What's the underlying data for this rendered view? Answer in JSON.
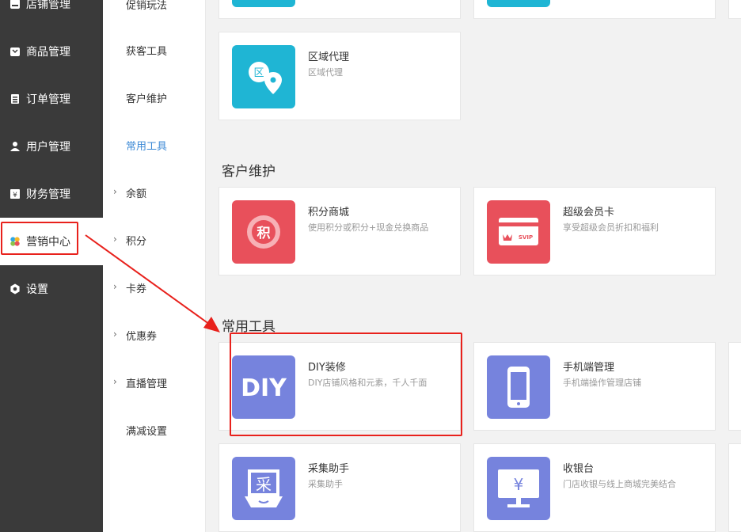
{
  "sidebar": {
    "items": [
      {
        "label": "店铺管理",
        "icon": "store-icon"
      },
      {
        "label": "商品管理",
        "icon": "goods-icon"
      },
      {
        "label": "订单管理",
        "icon": "order-icon"
      },
      {
        "label": "用户管理",
        "icon": "user-icon"
      },
      {
        "label": "财务管理",
        "icon": "finance-icon"
      },
      {
        "label": "营销中心",
        "icon": "marketing-icon"
      },
      {
        "label": "设置",
        "icon": "settings-icon"
      }
    ]
  },
  "subnav": {
    "items": [
      {
        "label": "促销玩法"
      },
      {
        "label": "获客工具"
      },
      {
        "label": "客户维护"
      },
      {
        "label": "常用工具"
      },
      {
        "label": "余额"
      },
      {
        "label": "积分"
      },
      {
        "label": "卡券"
      },
      {
        "label": "优惠券"
      },
      {
        "label": "直播管理"
      },
      {
        "label": "满减设置"
      }
    ]
  },
  "main": {
    "region_card": {
      "title": "区域代理",
      "desc": "区域代理",
      "icon_text": "区",
      "color": "#1fb5d4"
    },
    "sections": {
      "customer": "客户维护",
      "tools": "常用工具"
    },
    "customer_cards": [
      {
        "title": "积分商城",
        "desc": "使用积分或积分+现金兑换商品",
        "icon_text": "积",
        "color": "#e8505b"
      },
      {
        "title": "超级会员卡",
        "desc": "享受超级会员折扣和福利",
        "icon_text": "SVIP",
        "color": "#e8505b"
      }
    ],
    "tool_cards": [
      {
        "title": "DIY装修",
        "desc": "DIY店铺风格和元素，千人千面",
        "icon_text": "DIY",
        "color": "#7683dd"
      },
      {
        "title": "手机端管理",
        "desc": "手机端操作管理店铺",
        "color": "#7683dd"
      },
      {
        "title": "采集助手",
        "desc": "采集助手",
        "icon_text": "采",
        "color": "#7683dd"
      },
      {
        "title": "收银台",
        "desc": "门店收银与线上商城完美结合",
        "icon_text": "¥",
        "color": "#7683dd"
      }
    ]
  },
  "colors": {
    "annotation_red": "#e8211c",
    "active_blue": "#3d8ad6",
    "sidebar_bg": "#3a3a3a"
  }
}
